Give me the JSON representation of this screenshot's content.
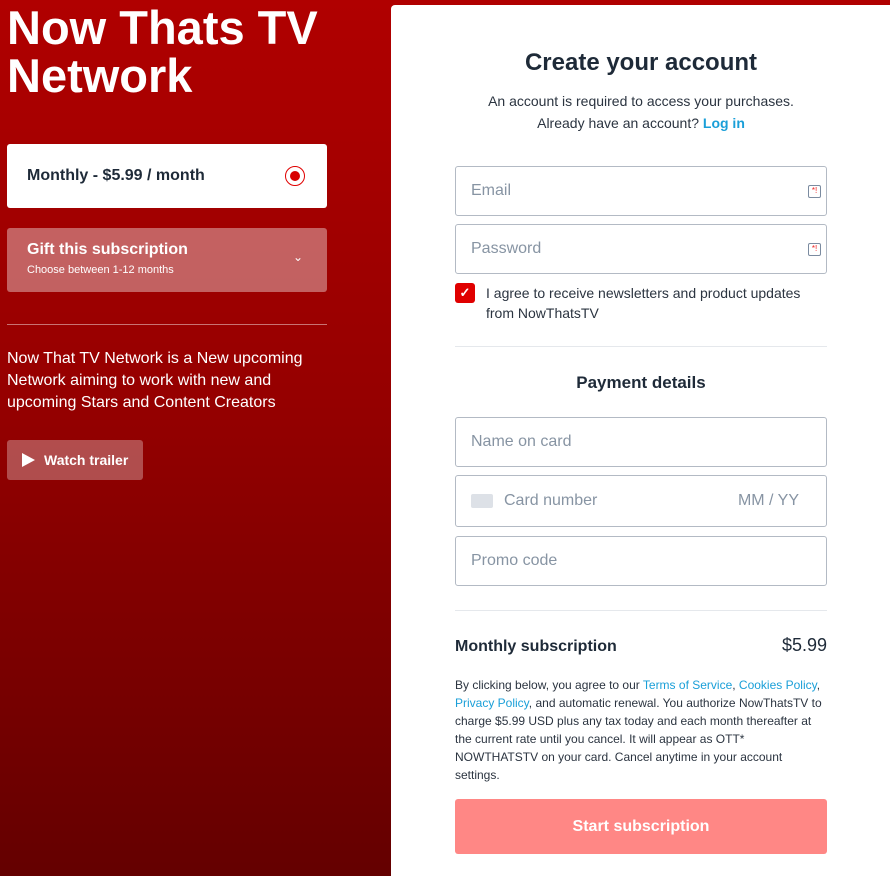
{
  "brand": {
    "title": "Now Thats TV Network"
  },
  "plan": {
    "label": "Monthly - $5.99 / month",
    "selected": true
  },
  "gift": {
    "title": "Gift this subscription",
    "subtitle": "Choose between 1-12 months",
    "chevron": "⌄"
  },
  "description": "Now That TV Network is a New upcoming Network aiming to work with new and upcoming Stars and Content Creators",
  "trailer": {
    "label": "Watch trailer"
  },
  "account": {
    "heading": "Create your account",
    "subtitle": "An account is required to access your purchases.",
    "login_prompt": "Already have an account?",
    "login_link": "Log in",
    "email_placeholder": "Email",
    "password_placeholder": "Password",
    "newsletter_checked": true,
    "newsletter_label": "I agree to receive newsletters and product updates from NowThatsTV"
  },
  "payment": {
    "heading": "Payment details",
    "name_placeholder": "Name on card",
    "card_placeholder": "Card number",
    "expiry_placeholder": "MM / YY",
    "promo_placeholder": "Promo code"
  },
  "summary": {
    "label": "Monthly subscription",
    "price": "$5.99"
  },
  "legal": {
    "prefix": "By clicking below, you agree to our ",
    "terms": "Terms of Service",
    "sep1": ", ",
    "cookies": "Cookies Policy",
    "sep2": ", ",
    "privacy": "Privacy Policy",
    "suffix": ", and automatic renewal. You authorize NowThatsTV to charge $5.99 USD plus any tax today and each month thereafter at the current rate until you cancel. It will appear as OTT* NOWTHATSTV on your card. Cancel anytime in your account settings."
  },
  "submit": {
    "label": "Start subscription"
  },
  "colors": {
    "brand_red": "#b00000",
    "accent_red": "#e00000",
    "link_blue": "#1a9fd8",
    "button_disabled": "#ff8785"
  }
}
